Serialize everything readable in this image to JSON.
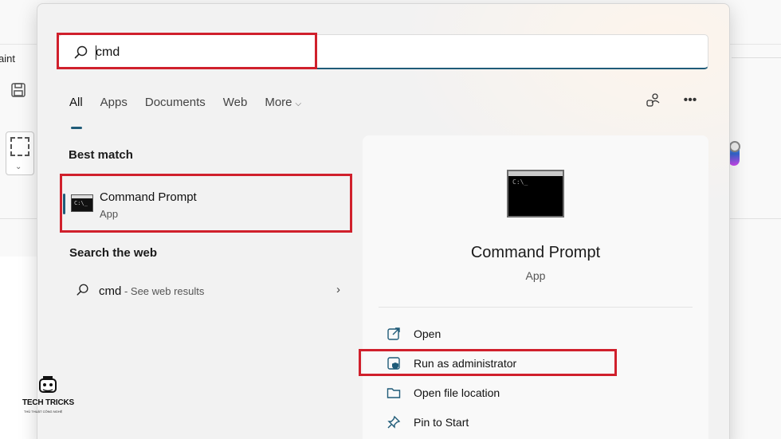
{
  "background_app": {
    "title_fragment": "aint"
  },
  "search": {
    "query": "cmd"
  },
  "tabs": [
    {
      "label": "All",
      "active": true
    },
    {
      "label": "Apps",
      "active": false
    },
    {
      "label": "Documents",
      "active": false
    },
    {
      "label": "Web",
      "active": false
    },
    {
      "label": "More",
      "active": false
    }
  ],
  "best_match": {
    "heading": "Best match",
    "name": "Command Prompt",
    "type": "App"
  },
  "search_web": {
    "heading": "Search the web",
    "query": "cmd",
    "sub": " - See web results"
  },
  "detail": {
    "name": "Command Prompt",
    "type": "App",
    "actions": [
      {
        "label": "Open",
        "icon": "open-icon"
      },
      {
        "label": "Run as administrator",
        "icon": "shield-icon"
      },
      {
        "label": "Open file location",
        "icon": "folder-icon"
      },
      {
        "label": "Pin to Start",
        "icon": "pin-icon"
      }
    ]
  },
  "watermark": {
    "title": "TECH TRICKS",
    "subtitle": "THỦ THUẬT CÔNG NGHỆ"
  },
  "colors": {
    "accent": "#1f5b78",
    "highlight": "#d0202c"
  }
}
